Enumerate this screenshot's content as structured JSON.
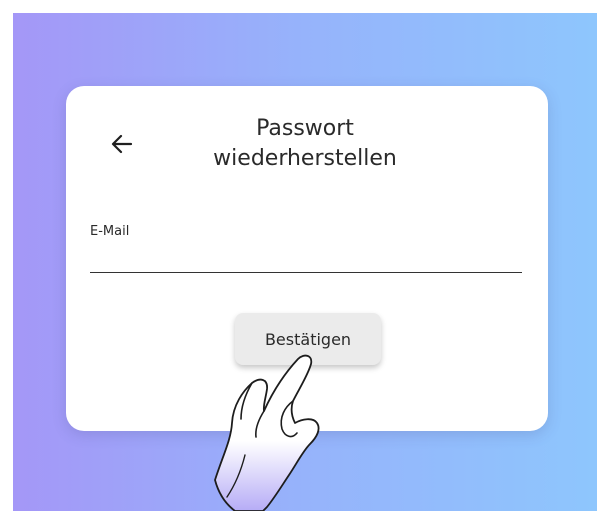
{
  "dialog": {
    "title": "Passwort\nwiederherstellen",
    "email_label": "E-Mail",
    "email_value": "",
    "confirm_label": "Bestätigen"
  },
  "icons": {
    "back": "arrow-left-icon",
    "pointer": "hand-pointer-icon"
  },
  "colors": {
    "gradient_start": "#a497f7",
    "gradient_end": "#8ec6fd",
    "card": "#ffffff",
    "button": "#ebebeb",
    "text": "#2a2a2a"
  }
}
